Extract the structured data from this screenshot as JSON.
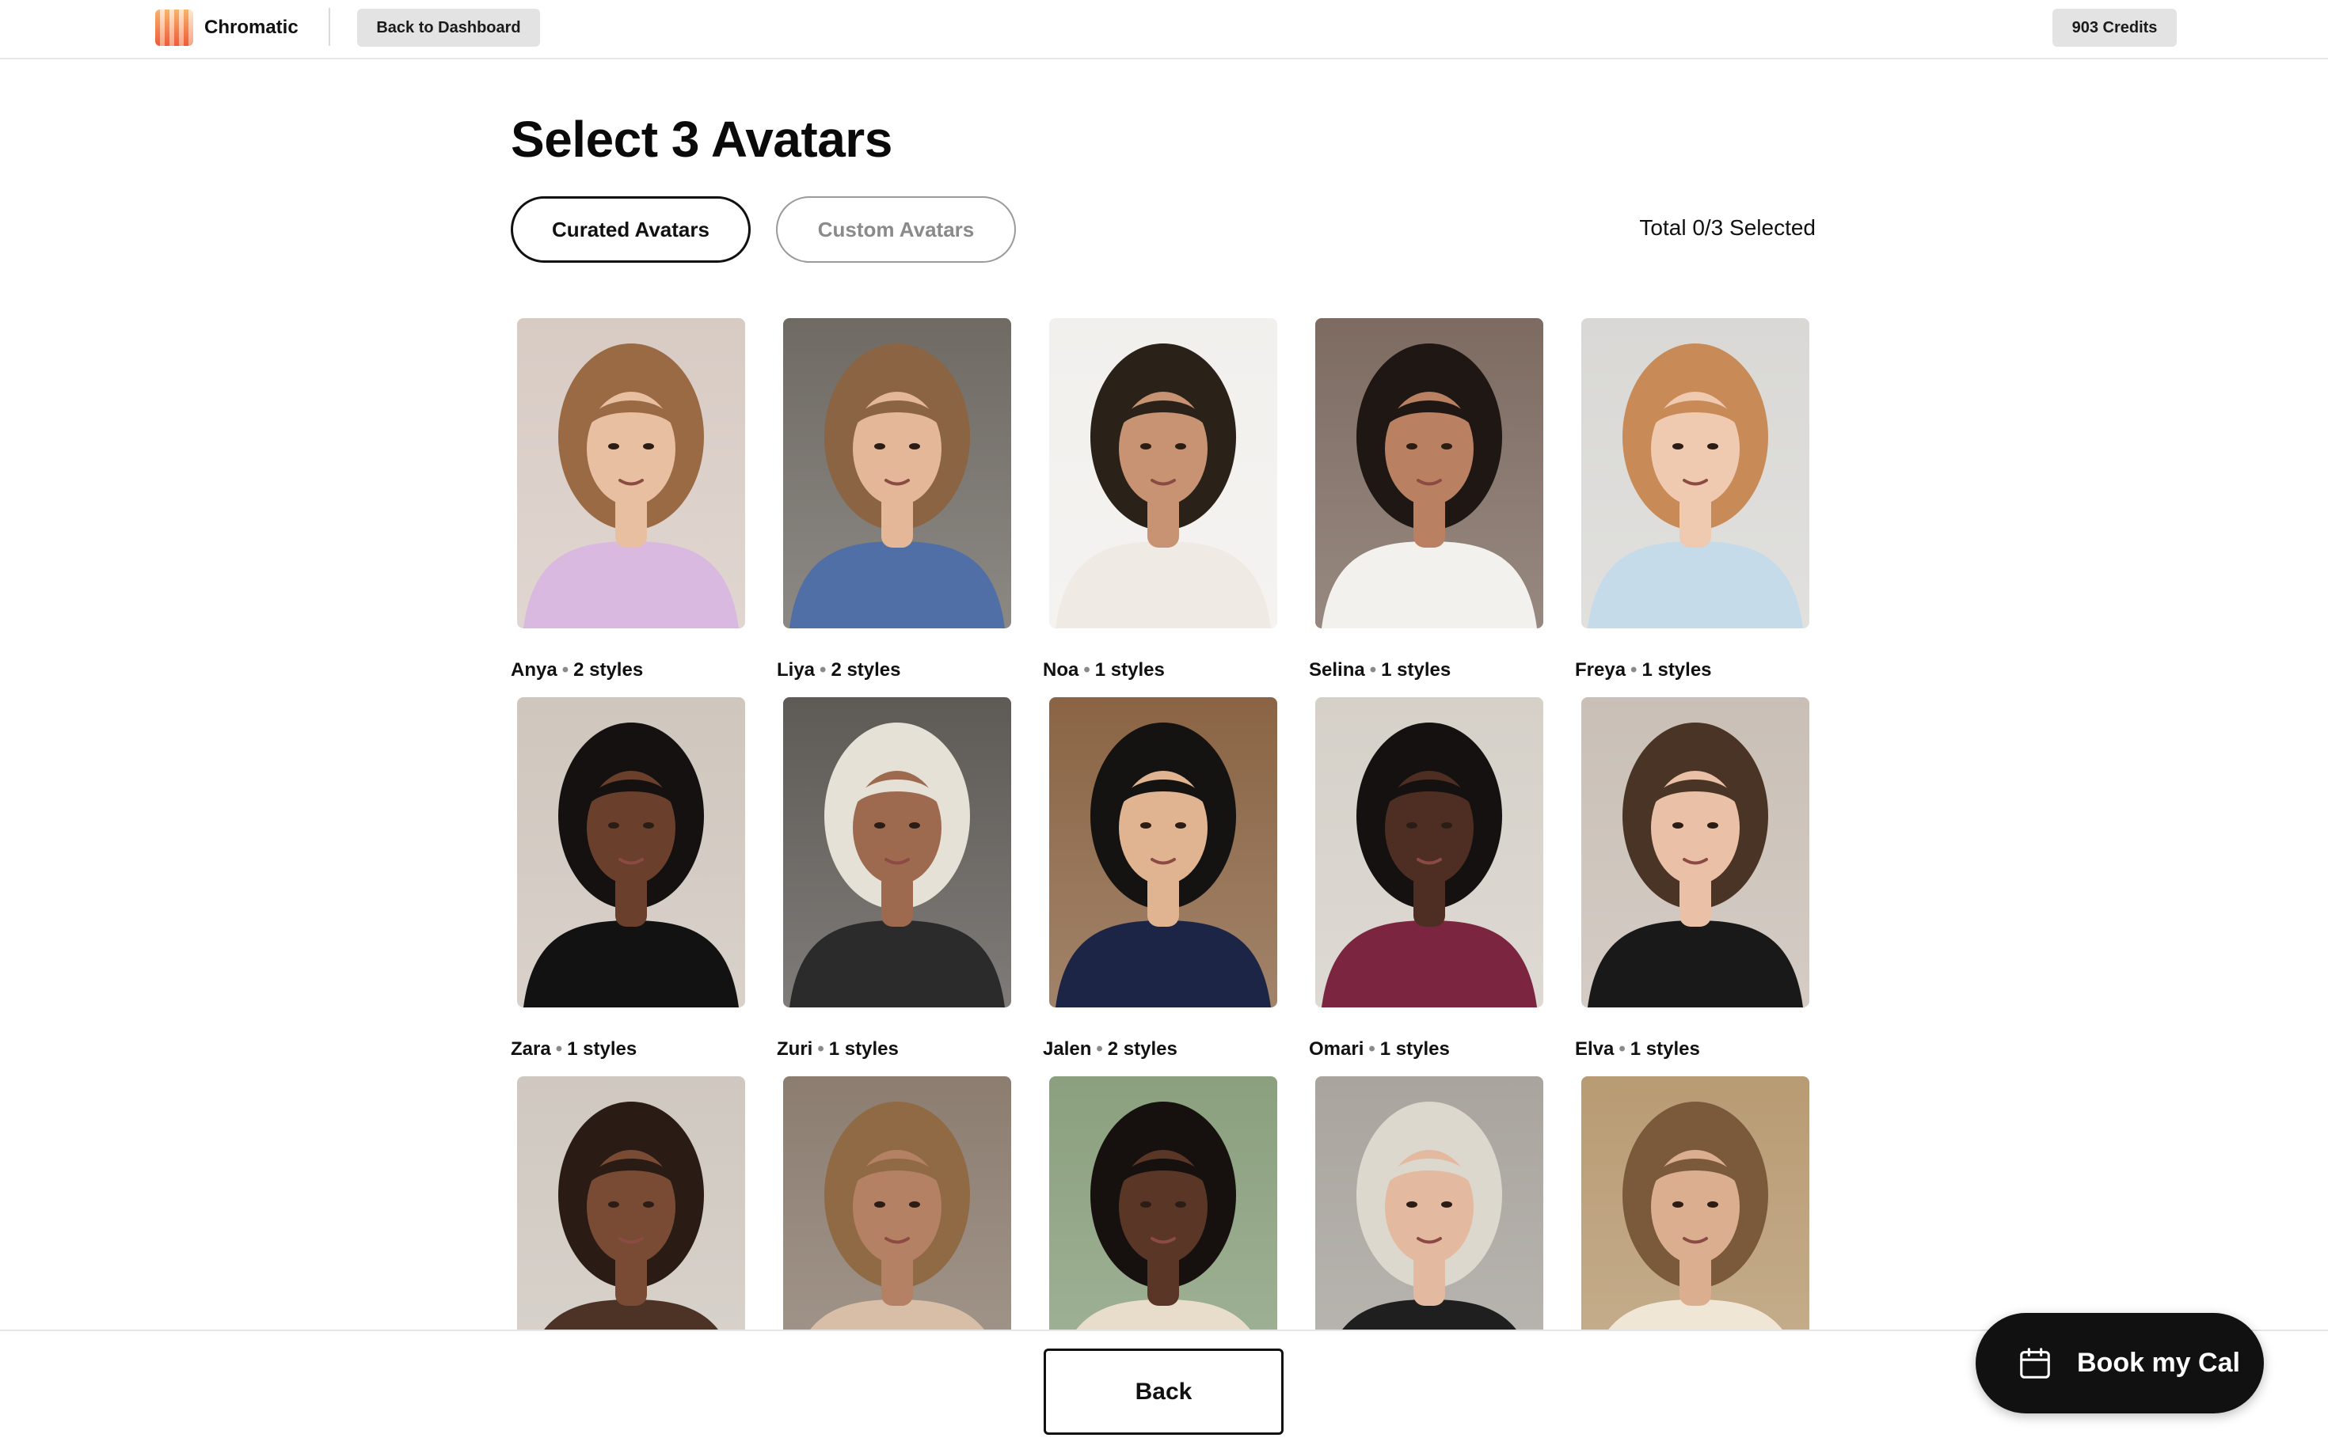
{
  "header": {
    "brand": "Chromatic",
    "back_label": "Back to Dashboard",
    "credits_label": "903 Credits"
  },
  "page": {
    "title": "Select 3 Avatars",
    "tabs": [
      {
        "label": "Curated Avatars",
        "active": true
      },
      {
        "label": "Custom Avatars",
        "active": false
      }
    ],
    "selection_status": "Total 0/3 Selected"
  },
  "avatars": [
    {
      "name": "Anya",
      "styles": "2 styles",
      "skin": "#e8bfa0",
      "hair": "#9a6a45",
      "shirt": "#d9b9df",
      "bg": "#d8cbc4"
    },
    {
      "name": "Liya",
      "styles": "2 styles",
      "skin": "#e3b797",
      "hair": "#8a6443",
      "shirt": "#4f6fa6",
      "bg": "#6f6a64"
    },
    {
      "name": "Noa",
      "styles": "1 styles",
      "skin": "#c79373",
      "hair": "#2a2119",
      "shirt": "#efebe4",
      "bg": "#f2f0ed"
    },
    {
      "name": "Selina",
      "styles": "1 styles",
      "skin": "#b98062",
      "hair": "#1e1714",
      "shirt": "#f3f1ee",
      "bg": "#7d6b61"
    },
    {
      "name": "Freya",
      "styles": "1 styles",
      "skin": "#f0c9b1",
      "hair": "#c88a57",
      "shirt": "#c6dbea",
      "bg": "#d9d8d5"
    },
    {
      "name": "Zara",
      "styles": "1 styles",
      "skin": "#6a3f2c",
      "hair": "#141110",
      "shirt": "#121212",
      "bg": "#cfc6bd"
    },
    {
      "name": "Zuri",
      "styles": "1 styles",
      "skin": "#9d6a50",
      "hair": "#e6e1d6",
      "shirt": "#2b2b2b",
      "bg": "#5e5a56"
    },
    {
      "name": "Jalen",
      "styles": "2 styles",
      "skin": "#e0b491",
      "hair": "#151212",
      "shirt": "#1d2547",
      "bg": "#8a6444"
    },
    {
      "name": "Omari",
      "styles": "1 styles",
      "skin": "#4e2e22",
      "hair": "#141110",
      "shirt": "#7c2540",
      "bg": "#d5d0c8"
    },
    {
      "name": "Elva",
      "styles": "1 styles",
      "skin": "#eac1a7",
      "hair": "#4a3426",
      "shirt": "#191919",
      "bg": "#c9bfb6"
    },
    {
      "name": "",
      "styles": "",
      "skin": "#7a4b34",
      "hair": "#2a1c14",
      "shirt": "#4d3226",
      "bg": "#cfc8c0"
    },
    {
      "name": "",
      "styles": "",
      "skin": "#b58164",
      "hair": "#8f6a45",
      "shirt": "#d8bea6",
      "bg": "#8c7d70"
    },
    {
      "name": "",
      "styles": "",
      "skin": "#5a3626",
      "hair": "#16110f",
      "shirt": "#e8dccb",
      "bg": "#8aa07e"
    },
    {
      "name": "",
      "styles": "",
      "skin": "#e3b9a0",
      "hair": "#ddd8ce",
      "shirt": "#1f1f1f",
      "bg": "#a9a49e"
    },
    {
      "name": "",
      "styles": "",
      "skin": "#dcae90",
      "hair": "#7a5a3a",
      "shirt": "#efe6d6",
      "bg": "#b89b73"
    }
  ],
  "footer": {
    "back_label": "Back",
    "book_label": "Book my Cal"
  }
}
